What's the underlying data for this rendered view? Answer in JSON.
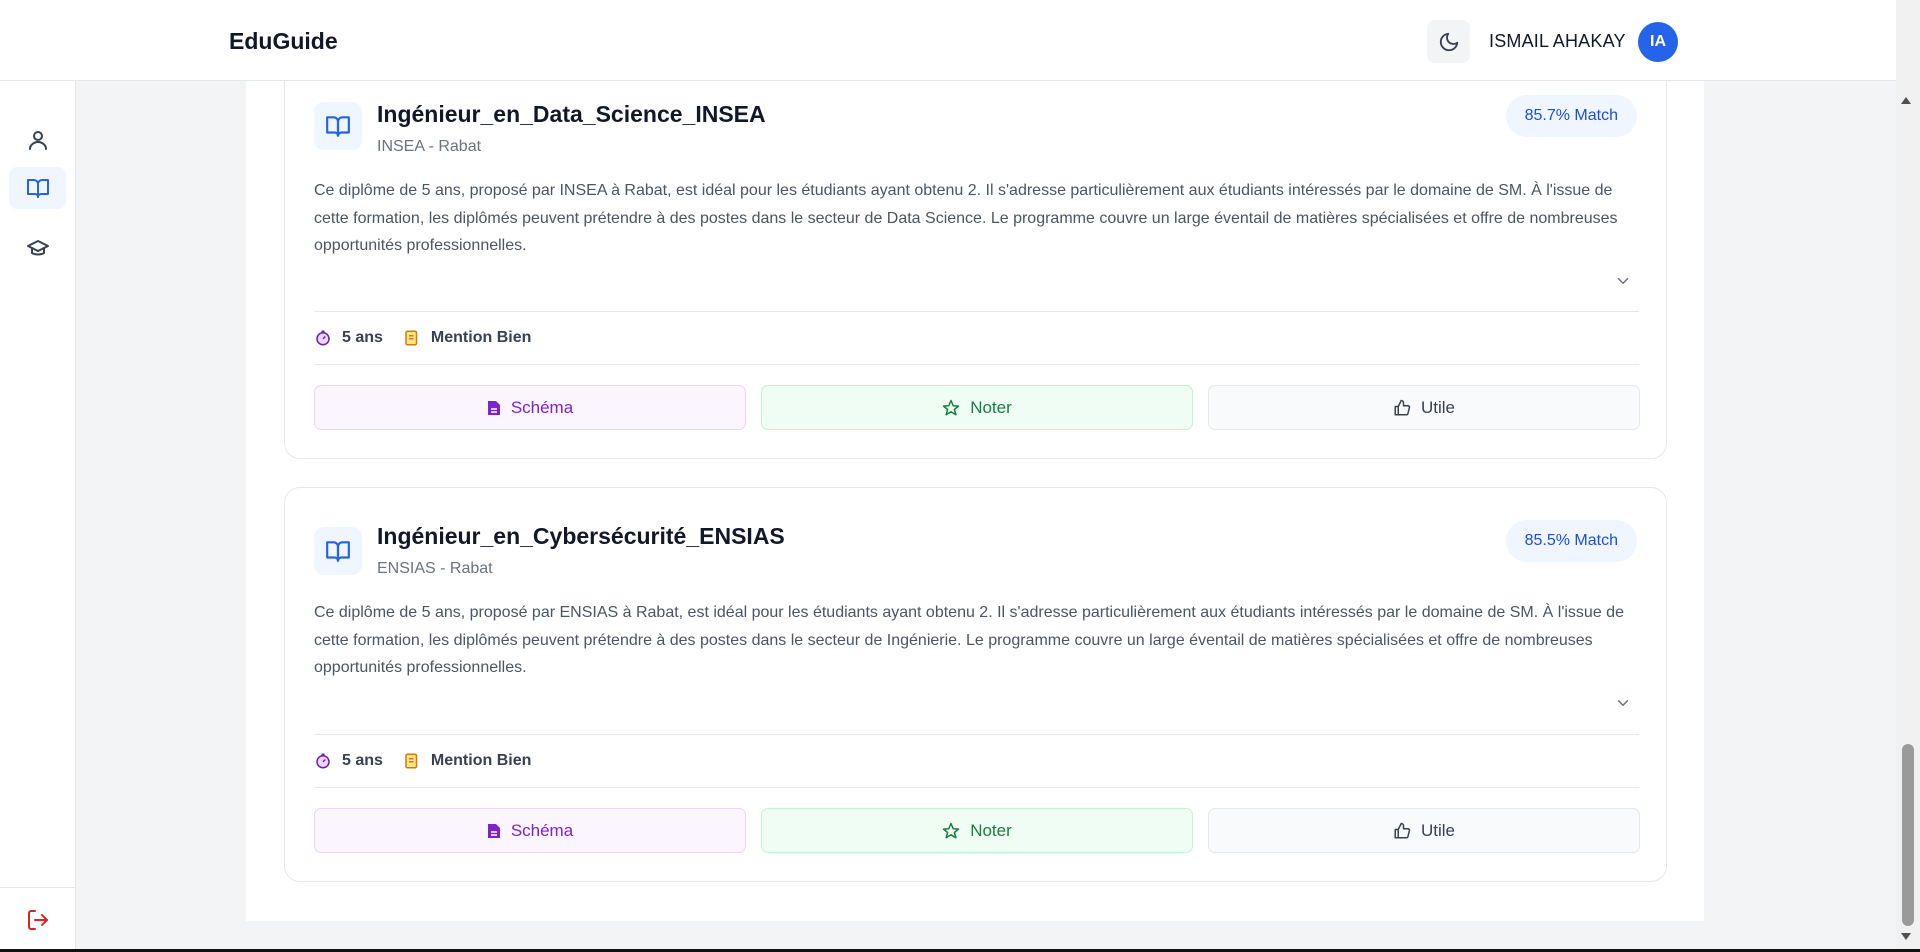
{
  "header": {
    "brand": "EduGuide",
    "user_name": "ISMAIL AHAKAY",
    "avatar_initials": "IA"
  },
  "sidebar": {
    "items": [
      {
        "icon": "user-icon",
        "active": false
      },
      {
        "icon": "book-open-icon",
        "active": true
      },
      {
        "icon": "graduation-cap-icon",
        "active": false
      }
    ],
    "logout_icon": "logout-icon"
  },
  "cards": [
    {
      "title": "Ingénieur_en_Data_Science_INSEA",
      "subtitle": "INSEA - Rabat",
      "match": "85.7% Match",
      "description": "Ce diplôme de 5 ans, proposé par INSEA à Rabat, est idéal pour les étudiants ayant obtenu 2. Il s'adresse particulièrement aux étudiants intéressés par le domaine de SM. À l'issue de cette formation, les diplômés peuvent prétendre à des postes dans le secteur de Data Science. Le programme couvre un large éventail de matières spécialisées et offre de nombreuses opportunités professionnelles.",
      "duration": "5 ans",
      "mention": "Mention Bien",
      "buttons": {
        "schema": "Schéma",
        "noter": "Noter",
        "utile": "Utile"
      }
    },
    {
      "title": "Ingénieur_en_Cybersécurité_ENSIAS",
      "subtitle": "ENSIAS - Rabat",
      "match": "85.5% Match",
      "description": "Ce diplôme de 5 ans, proposé par ENSIAS à Rabat, est idéal pour les étudiants ayant obtenu 2. Il s'adresse particulièrement aux étudiants intéressés par le domaine de SM. À l'issue de cette formation, les diplômés peuvent prétendre à des postes dans le secteur de Ingénierie. Le programme couvre un large éventail de matières spécialisées et offre de nombreuses opportunités professionnelles.",
      "duration": "5 ans",
      "mention": "Mention Bien",
      "buttons": {
        "schema": "Schéma",
        "noter": "Noter",
        "utile": "Utile"
      }
    }
  ],
  "colors": {
    "accent": "#2563eb",
    "schema": "#7e22ce",
    "noter": "#15803d",
    "logout": "#dc2626"
  }
}
